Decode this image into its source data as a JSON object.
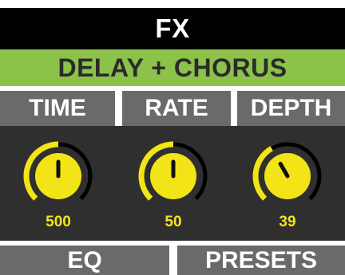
{
  "header": {
    "title": "FX"
  },
  "effect": {
    "name": "DELAY + CHORUS"
  },
  "params": [
    {
      "label": "TIME",
      "value": "500",
      "level": 0.5
    },
    {
      "label": "RATE",
      "value": "50",
      "level": 0.5
    },
    {
      "label": "DEPTH",
      "value": "39",
      "level": 0.39
    }
  ],
  "buttons": {
    "eq": "EQ",
    "presets": "PRESETS"
  },
  "colors": {
    "title_bg": "#000000",
    "effect_bg": "#8cc24a",
    "label_bg": "#6a6a6a",
    "panel_bg": "#2f2f2f",
    "knob_yellow": "#f2e416",
    "knob_track": "#000000"
  }
}
